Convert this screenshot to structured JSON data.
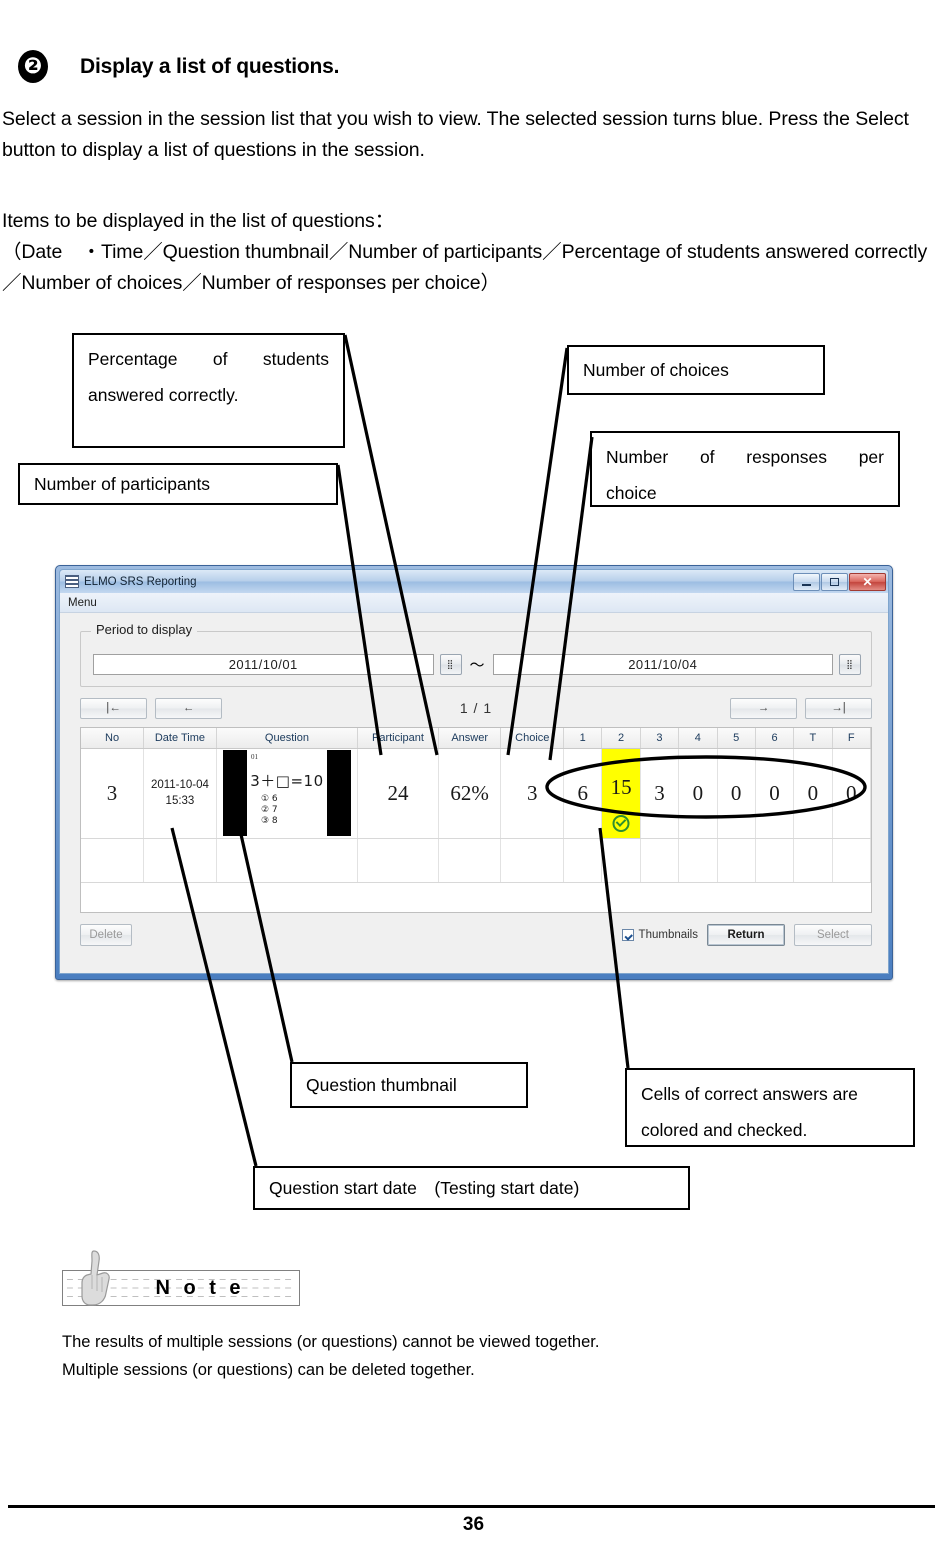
{
  "header": {
    "step_number": "❷",
    "title": "Display a list of questions."
  },
  "intro": {
    "paragraph1": "Select a session in the session list that you wish to view. The selected session turns blue. Press the Select button to display a list of questions in the session.",
    "paragraph2": "Items to be displayed in the list of questions：\n（Date　・Time／Question thumbnail／Number of participants／Percentage of students answered correctly／Number of choices／Number of responses per choice）"
  },
  "callouts": {
    "percentage_line1": "Percentage of students",
    "percentage_line2": "answered correctly.",
    "participants": "Number of participants",
    "choices": "Number of choices",
    "responses_line1": "Number of responses per",
    "responses_line2": "choice",
    "thumbnail": "Question thumbnail",
    "cells_line1": "Cells of correct answers are",
    "cells_line2": "colored and checked.",
    "start_date": "Question start date　(Testing start date)"
  },
  "app": {
    "window_title": "ELMO SRS Reporting",
    "menu_label": "Menu",
    "window_buttons": {
      "minimize": "minimize-icon",
      "maximize": "maximize-icon",
      "close": "✕"
    },
    "period": {
      "legend": "Period to display",
      "start_date": "2011/10/01",
      "end_date": "2011/10/04",
      "separator": "〜",
      "picker_label": "⣿"
    },
    "pager": {
      "first": "|←",
      "prev": "←",
      "page": "1 / 1",
      "next": "→",
      "last": "→|"
    },
    "grid": {
      "headers": [
        "No",
        "Date Time",
        "Question",
        "Participant",
        "Answer",
        "Choice",
        "1",
        "2",
        "3",
        "4",
        "5",
        "6",
        "T",
        "F"
      ],
      "rows": [
        {
          "no": "3",
          "date": "2011-10-04",
          "time": "15:33",
          "thumbnail": {
            "mark": "01",
            "equation": "3＋□=10",
            "options": [
              "① 6",
              "② 7",
              "③ 8"
            ]
          },
          "participant": "24",
          "answer": "62%",
          "choice": "3",
          "responses": [
            "6",
            "15",
            "3",
            "0",
            "0",
            "0",
            "0",
            "0"
          ],
          "correct_index": 1,
          "correct_mark": "check-icon"
        }
      ]
    },
    "buttons": {
      "delete": "Delete",
      "thumbnails_checkbox": "Thumbnails",
      "thumbnails_checked": true,
      "return": "Return",
      "select": "Select"
    }
  },
  "note": {
    "label": "N o t e",
    "line1": "The results of multiple sessions (or questions) cannot be viewed together.",
    "line2": "Multiple sessions (or questions) can be deleted together."
  },
  "footer": {
    "page_number": "36"
  },
  "colors": {
    "highlight": "#ffff00",
    "check": "#2f8f2f",
    "titlebar_accent": "#4a7ec0"
  }
}
